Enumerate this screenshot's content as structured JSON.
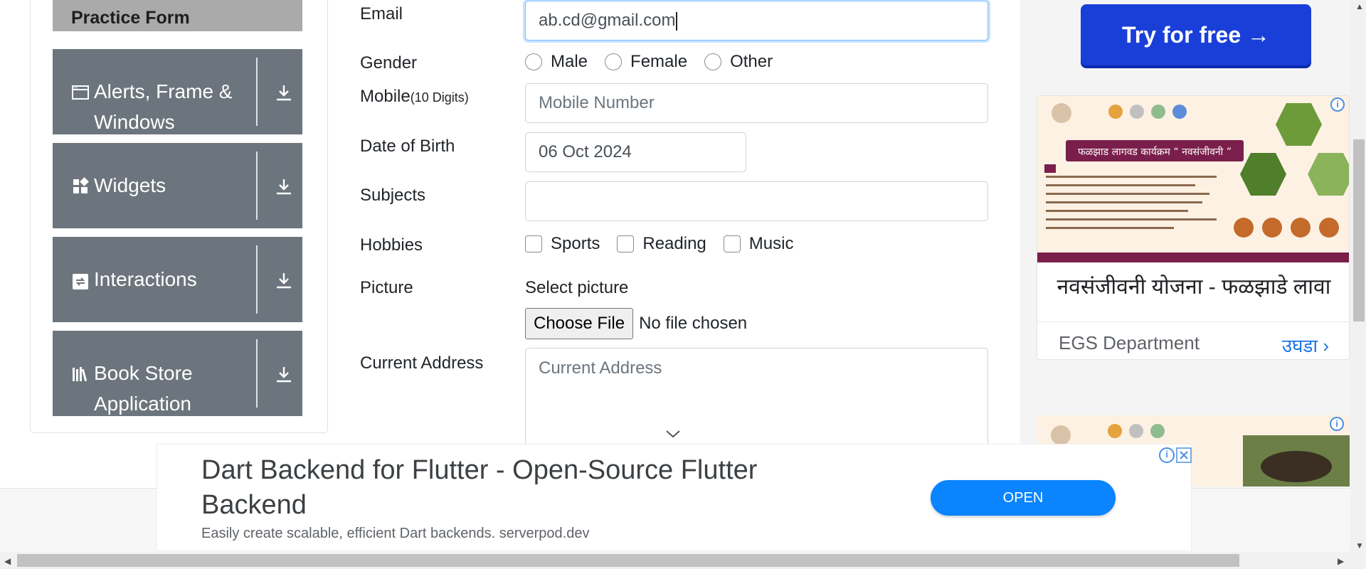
{
  "sidebar": {
    "practice_form_label": "Practice Form",
    "groups": [
      {
        "label": "Alerts, Frame & Windows",
        "icon": "window-icon"
      },
      {
        "label": "Widgets",
        "icon": "widgets-icon"
      },
      {
        "label": "Interactions",
        "icon": "interactions-icon"
      },
      {
        "label": "Book Store Application",
        "icon": "books-icon"
      }
    ]
  },
  "form": {
    "email": {
      "label": "Email",
      "value": "ab.cd@gmail.com"
    },
    "gender": {
      "label": "Gender",
      "options": [
        "Male",
        "Female",
        "Other"
      ]
    },
    "mobile": {
      "label": "Mobile",
      "label_hint": "(10 Digits)",
      "placeholder": "Mobile Number"
    },
    "dob": {
      "label": "Date of Birth",
      "value": "06 Oct 2024"
    },
    "subjects": {
      "label": "Subjects",
      "value": ""
    },
    "hobbies": {
      "label": "Hobbies",
      "options": [
        "Sports",
        "Reading",
        "Music"
      ]
    },
    "picture": {
      "label": "Picture",
      "select_label": "Select picture",
      "button": "Choose File",
      "status": "No file chosen"
    },
    "address": {
      "label": "Current Address",
      "placeholder": "Current Address"
    }
  },
  "right_ads": {
    "try_button": "Try for free →",
    "card_title": "नवसंजीवनी योजना - फळझाडे लावा",
    "card_source": "EGS Department",
    "card_open": "उघडा",
    "image_banner_text": "फळझाड लागवड कार्यक्रम “ नवसंजीवनी ”"
  },
  "bottom_ad": {
    "title": "Dart Backend for Flutter - Open-Source Flutter Backend",
    "description": "Easily create scalable, efficient Dart backends. serverpod.dev",
    "open_button": "OPEN"
  },
  "colors": {
    "sidebar_group": "#6c757d",
    "practice_active": "#aaaaaa",
    "focus_border": "#80bdff",
    "try_button": "#1a3fd8",
    "open_button": "#0a84ff"
  }
}
